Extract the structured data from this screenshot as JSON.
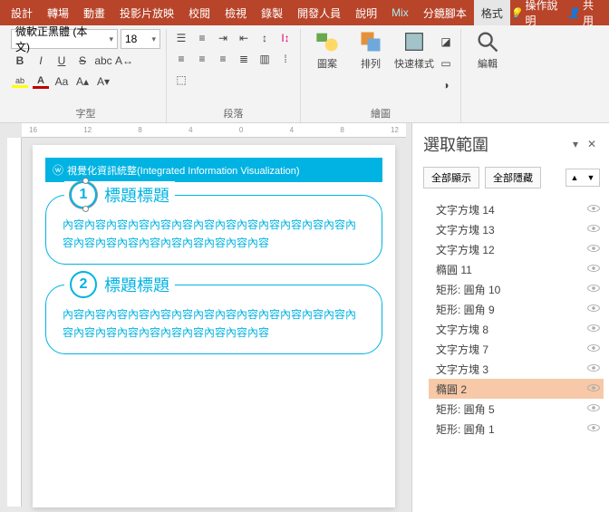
{
  "tabs": [
    "設計",
    "轉場",
    "動畫",
    "投影片放映",
    "校閱",
    "檢視",
    "錄製",
    "開發人員",
    "說明",
    "Mix",
    "分鏡腳本",
    "格式"
  ],
  "activeTab": "格式",
  "help": "操作說明",
  "share": "共用",
  "ribbon": {
    "font": {
      "name": "微軟正黑體 (本文)",
      "size": "18",
      "label": "字型"
    },
    "para": {
      "label": "段落"
    },
    "draw": {
      "label": "繪圖",
      "picture": "圖案",
      "arrange": "排列",
      "quick": "快速樣式"
    },
    "edit": {
      "label": "編輯"
    }
  },
  "slide": {
    "title": "視覺化資訊統整(Integrated Information Visualization)",
    "blocks": [
      {
        "num": "1",
        "title": "標題標題",
        "content": "內容內容內容內容內容內容內容內容內容內容內容內容內容內容內容內容內容內容內容內容內容內容內容"
      },
      {
        "num": "2",
        "title": "標題標題",
        "content": "內容內容內容內容內容內容內容內容內容內容內容內容內容內容內容內容內容內容內容內容內容內容內容"
      }
    ]
  },
  "selection": {
    "title": "選取範圍",
    "showAll": "全部顯示",
    "hideAll": "全部隱藏",
    "items": [
      "文字方塊 14",
      "文字方塊 13",
      "文字方塊 12",
      "橢圓 11",
      "矩形: 圓角 10",
      "矩形: 圓角 9",
      "文字方塊 8",
      "文字方塊 7",
      "文字方塊 3",
      "橢圓 2",
      "矩形: 圓角 5",
      "矩形: 圓角 1"
    ],
    "activeIndex": 9
  }
}
